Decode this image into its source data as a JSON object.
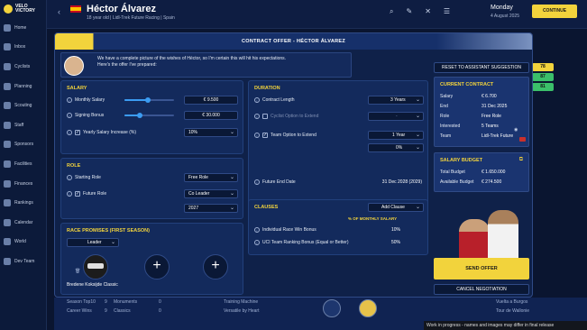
{
  "app": {
    "logo_top": "VELO",
    "logo_bottom": "VICTORY"
  },
  "sidebar": {
    "items": [
      {
        "label": "Home",
        "icon": "home-icon"
      },
      {
        "label": "Inbox",
        "icon": "mail-icon"
      },
      {
        "label": "Cyclists",
        "icon": "bike-icon"
      },
      {
        "label": "Planning",
        "icon": "calendar-icon"
      },
      {
        "label": "Scouting",
        "icon": "search-icon"
      },
      {
        "label": "Staff",
        "icon": "people-icon"
      },
      {
        "label": "Sponsors",
        "icon": "handshake-icon"
      },
      {
        "label": "Facilities",
        "icon": "building-icon"
      },
      {
        "label": "Finances",
        "icon": "money-icon"
      },
      {
        "label": "Rankings",
        "icon": "trophy-icon"
      },
      {
        "label": "Calendar",
        "icon": "calendar-icon"
      },
      {
        "label": "World",
        "icon": "globe-icon"
      },
      {
        "label": "Dev Team",
        "icon": "team-icon"
      }
    ]
  },
  "topbar": {
    "name": "Héctor Álvarez",
    "subtitle": "18 year old | Lidl-Trek Future Racing | Spain",
    "day": "Monday",
    "date": "4 August 2025",
    "continue_label": "CONTINUE"
  },
  "modal": {
    "title": "CONTRACT OFFER - HÉCTOR ÁLVAREZ",
    "agent_message_1": "We have a complete picture of the wishes of Héctor, so I'm certain this will hit his expectations.",
    "agent_message_2": "Here's the offer I've prepared:",
    "salary": {
      "title": "SALARY",
      "monthly_label": "Monthly Salary",
      "monthly_value": "€ 9.500",
      "monthly_slider": 0.48,
      "signing_label": "Signing Bonus",
      "signing_value": "€ 30.000",
      "signing_slider": 0.3,
      "yearly_label": "Yearly Salary Increase (%)",
      "yearly_value": "10%"
    },
    "duration": {
      "title": "DURATION",
      "contract_length_label": "Contract Length",
      "contract_length_value": "3 Years",
      "cyclist_option_label": "Cyclist Option to Extend",
      "cyclist_option_value": "-",
      "team_option_label": "Team Option to Extend",
      "team_option_years": "1 Year",
      "team_option_pct": "0%",
      "future_end_label": "Future End Date",
      "future_end_value": "31 Dec 2028 (2029)"
    },
    "role": {
      "title": "ROLE",
      "starting_label": "Starting Role",
      "starting_value": "Free Role",
      "future_label": "Future Role",
      "future_value": "Co Leader",
      "future_year": "2027"
    },
    "clauses": {
      "title": "CLAUSES",
      "add_label": "Add Clause",
      "column_header": "% OF MONTHLY SALARY",
      "items": [
        {
          "label": "Individual Race Win Bonus",
          "value": "10%"
        },
        {
          "label": "UCI Team Ranking Bonus (Equal or Better)",
          "value": "50%"
        }
      ]
    },
    "promises": {
      "title": "RACE PROMISES (FIRST SEASON)",
      "role_value": "Leader",
      "race_name": "Bredene Koksijde Classic"
    },
    "reset_label": "RESET TO ASSISTANT SUGGESTION",
    "current_contract": {
      "title": "CURRENT CONTRACT",
      "rows": [
        {
          "k": "Salary",
          "v": "€ 6.700"
        },
        {
          "k": "End",
          "v": "31 Dec 2025"
        },
        {
          "k": "Role",
          "v": "Free Role"
        },
        {
          "k": "Interested",
          "v": "5 Teams"
        },
        {
          "k": "Team",
          "v": "Lidl-Trek Future"
        }
      ]
    },
    "salary_budget": {
      "title": "SALARY BUDGET",
      "rows": [
        {
          "k": "Total Budget",
          "v": "€ 1.650.000"
        },
        {
          "k": "Available Budget",
          "v": "€ 274.500"
        }
      ]
    },
    "send_label": "SEND OFFER",
    "cancel_label": "CANCEL NEGOTIATION"
  },
  "background": {
    "rows": [
      {
        "a": "Season Top10",
        "b": "9",
        "c": "Monuments",
        "d": "0",
        "e": "Training Machine",
        "f": "Vuelta a Burgos"
      },
      {
        "a": "Career Wins",
        "b": "9",
        "c": "Classics",
        "d": "0",
        "e": "Versatile by Heart",
        "f": "Tour de Wallonie"
      }
    ],
    "ratings": [
      "78",
      "87",
      "81"
    ],
    "wip": "Work in progress - names and images may differ in final release"
  },
  "colors": {
    "accent": "#f2d33c",
    "panel": "#132a5c",
    "background": "#0a1530"
  }
}
